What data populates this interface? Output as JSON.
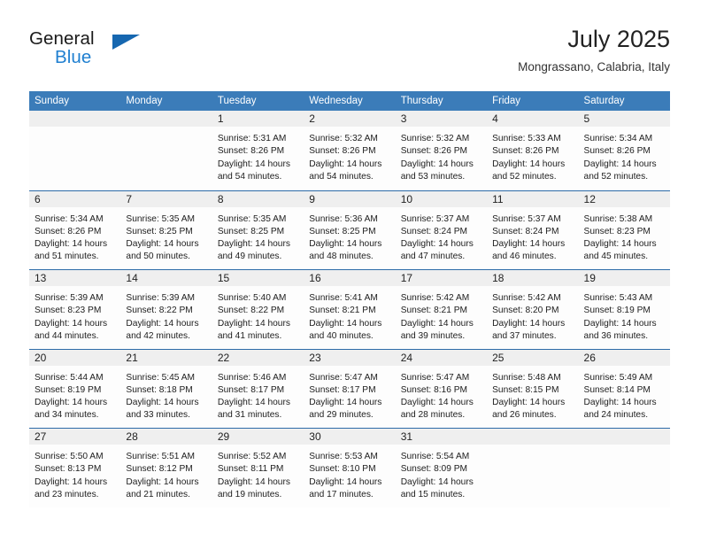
{
  "brand": {
    "name_part1": "General",
    "name_part2": "Blue",
    "accent_color": "#1f7fd0",
    "triangle_color": "#1667b0"
  },
  "header": {
    "title": "July 2025",
    "subtitle": "Mongrassano, Calabria, Italy"
  },
  "theme": {
    "header_blue": "#3b7cb9",
    "rule_blue": "#2d6ba8",
    "numband_gray": "#efefef"
  },
  "weekdays": [
    "Sunday",
    "Monday",
    "Tuesday",
    "Wednesday",
    "Thursday",
    "Friday",
    "Saturday"
  ],
  "weeks": [
    [
      {
        "day": "",
        "lines": []
      },
      {
        "day": "",
        "lines": []
      },
      {
        "day": "1",
        "lines": [
          "Sunrise: 5:31 AM",
          "Sunset: 8:26 PM",
          "Daylight: 14 hours",
          "and 54 minutes."
        ]
      },
      {
        "day": "2",
        "lines": [
          "Sunrise: 5:32 AM",
          "Sunset: 8:26 PM",
          "Daylight: 14 hours",
          "and 54 minutes."
        ]
      },
      {
        "day": "3",
        "lines": [
          "Sunrise: 5:32 AM",
          "Sunset: 8:26 PM",
          "Daylight: 14 hours",
          "and 53 minutes."
        ]
      },
      {
        "day": "4",
        "lines": [
          "Sunrise: 5:33 AM",
          "Sunset: 8:26 PM",
          "Daylight: 14 hours",
          "and 52 minutes."
        ]
      },
      {
        "day": "5",
        "lines": [
          "Sunrise: 5:34 AM",
          "Sunset: 8:26 PM",
          "Daylight: 14 hours",
          "and 52 minutes."
        ]
      }
    ],
    [
      {
        "day": "6",
        "lines": [
          "Sunrise: 5:34 AM",
          "Sunset: 8:26 PM",
          "Daylight: 14 hours",
          "and 51 minutes."
        ]
      },
      {
        "day": "7",
        "lines": [
          "Sunrise: 5:35 AM",
          "Sunset: 8:25 PM",
          "Daylight: 14 hours",
          "and 50 minutes."
        ]
      },
      {
        "day": "8",
        "lines": [
          "Sunrise: 5:35 AM",
          "Sunset: 8:25 PM",
          "Daylight: 14 hours",
          "and 49 minutes."
        ]
      },
      {
        "day": "9",
        "lines": [
          "Sunrise: 5:36 AM",
          "Sunset: 8:25 PM",
          "Daylight: 14 hours",
          "and 48 minutes."
        ]
      },
      {
        "day": "10",
        "lines": [
          "Sunrise: 5:37 AM",
          "Sunset: 8:24 PM",
          "Daylight: 14 hours",
          "and 47 minutes."
        ]
      },
      {
        "day": "11",
        "lines": [
          "Sunrise: 5:37 AM",
          "Sunset: 8:24 PM",
          "Daylight: 14 hours",
          "and 46 minutes."
        ]
      },
      {
        "day": "12",
        "lines": [
          "Sunrise: 5:38 AM",
          "Sunset: 8:23 PM",
          "Daylight: 14 hours",
          "and 45 minutes."
        ]
      }
    ],
    [
      {
        "day": "13",
        "lines": [
          "Sunrise: 5:39 AM",
          "Sunset: 8:23 PM",
          "Daylight: 14 hours",
          "and 44 minutes."
        ]
      },
      {
        "day": "14",
        "lines": [
          "Sunrise: 5:39 AM",
          "Sunset: 8:22 PM",
          "Daylight: 14 hours",
          "and 42 minutes."
        ]
      },
      {
        "day": "15",
        "lines": [
          "Sunrise: 5:40 AM",
          "Sunset: 8:22 PM",
          "Daylight: 14 hours",
          "and 41 minutes."
        ]
      },
      {
        "day": "16",
        "lines": [
          "Sunrise: 5:41 AM",
          "Sunset: 8:21 PM",
          "Daylight: 14 hours",
          "and 40 minutes."
        ]
      },
      {
        "day": "17",
        "lines": [
          "Sunrise: 5:42 AM",
          "Sunset: 8:21 PM",
          "Daylight: 14 hours",
          "and 39 minutes."
        ]
      },
      {
        "day": "18",
        "lines": [
          "Sunrise: 5:42 AM",
          "Sunset: 8:20 PM",
          "Daylight: 14 hours",
          "and 37 minutes."
        ]
      },
      {
        "day": "19",
        "lines": [
          "Sunrise: 5:43 AM",
          "Sunset: 8:19 PM",
          "Daylight: 14 hours",
          "and 36 minutes."
        ]
      }
    ],
    [
      {
        "day": "20",
        "lines": [
          "Sunrise: 5:44 AM",
          "Sunset: 8:19 PM",
          "Daylight: 14 hours",
          "and 34 minutes."
        ]
      },
      {
        "day": "21",
        "lines": [
          "Sunrise: 5:45 AM",
          "Sunset: 8:18 PM",
          "Daylight: 14 hours",
          "and 33 minutes."
        ]
      },
      {
        "day": "22",
        "lines": [
          "Sunrise: 5:46 AM",
          "Sunset: 8:17 PM",
          "Daylight: 14 hours",
          "and 31 minutes."
        ]
      },
      {
        "day": "23",
        "lines": [
          "Sunrise: 5:47 AM",
          "Sunset: 8:17 PM",
          "Daylight: 14 hours",
          "and 29 minutes."
        ]
      },
      {
        "day": "24",
        "lines": [
          "Sunrise: 5:47 AM",
          "Sunset: 8:16 PM",
          "Daylight: 14 hours",
          "and 28 minutes."
        ]
      },
      {
        "day": "25",
        "lines": [
          "Sunrise: 5:48 AM",
          "Sunset: 8:15 PM",
          "Daylight: 14 hours",
          "and 26 minutes."
        ]
      },
      {
        "day": "26",
        "lines": [
          "Sunrise: 5:49 AM",
          "Sunset: 8:14 PM",
          "Daylight: 14 hours",
          "and 24 minutes."
        ]
      }
    ],
    [
      {
        "day": "27",
        "lines": [
          "Sunrise: 5:50 AM",
          "Sunset: 8:13 PM",
          "Daylight: 14 hours",
          "and 23 minutes."
        ]
      },
      {
        "day": "28",
        "lines": [
          "Sunrise: 5:51 AM",
          "Sunset: 8:12 PM",
          "Daylight: 14 hours",
          "and 21 minutes."
        ]
      },
      {
        "day": "29",
        "lines": [
          "Sunrise: 5:52 AM",
          "Sunset: 8:11 PM",
          "Daylight: 14 hours",
          "and 19 minutes."
        ]
      },
      {
        "day": "30",
        "lines": [
          "Sunrise: 5:53 AM",
          "Sunset: 8:10 PM",
          "Daylight: 14 hours",
          "and 17 minutes."
        ]
      },
      {
        "day": "31",
        "lines": [
          "Sunrise: 5:54 AM",
          "Sunset: 8:09 PM",
          "Daylight: 14 hours",
          "and 15 minutes."
        ]
      },
      {
        "day": "",
        "lines": []
      },
      {
        "day": "",
        "lines": []
      }
    ]
  ]
}
